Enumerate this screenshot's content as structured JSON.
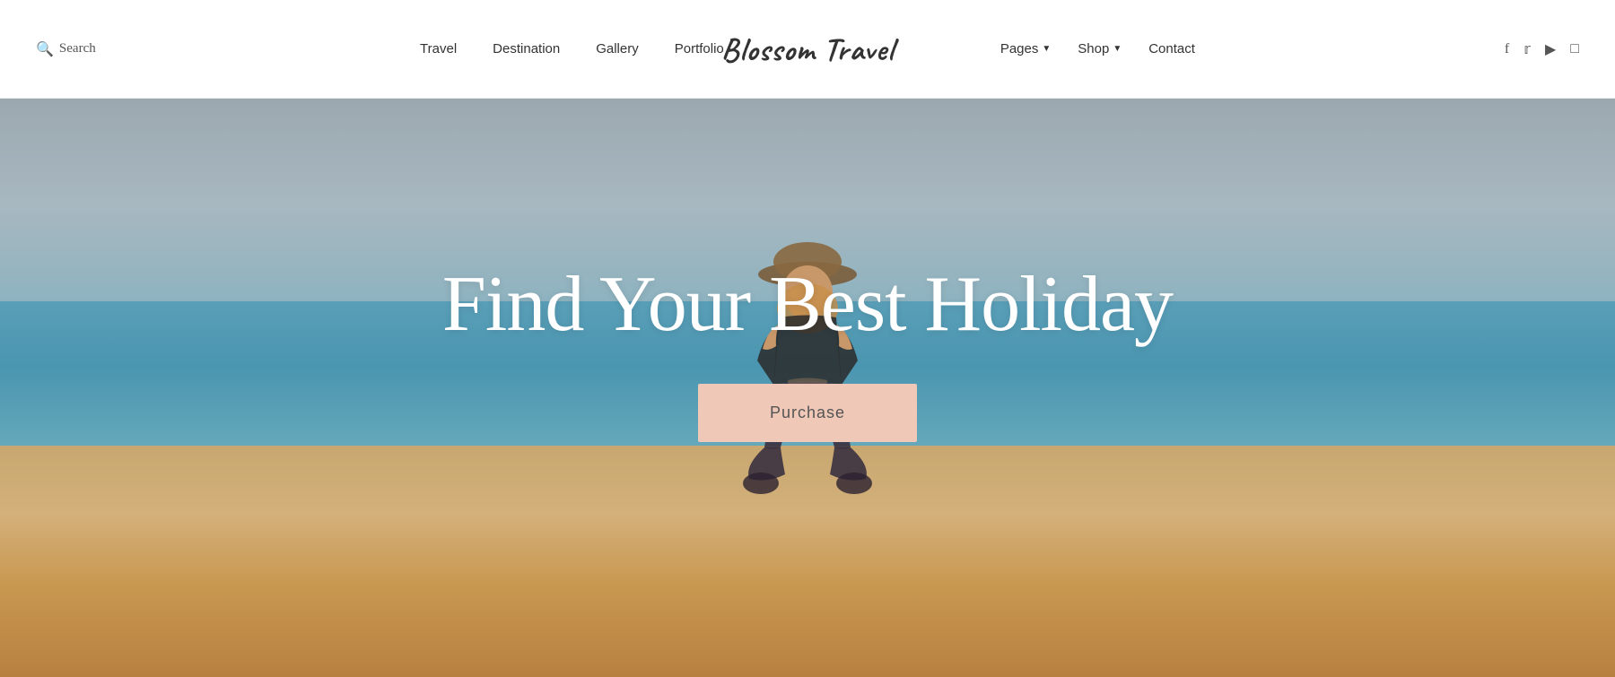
{
  "header": {
    "search_label": "Search",
    "logo": "Blossom Travel",
    "nav_left": [
      {
        "id": "travel",
        "label": "Travel"
      },
      {
        "id": "destination",
        "label": "Destination"
      },
      {
        "id": "gallery",
        "label": "Gallery"
      },
      {
        "id": "portfolio",
        "label": "Portfolio"
      }
    ],
    "nav_right": [
      {
        "id": "pages",
        "label": "Pages",
        "has_dropdown": true
      },
      {
        "id": "shop",
        "label": "Shop",
        "has_dropdown": true
      },
      {
        "id": "contact",
        "label": "Contact",
        "has_dropdown": false
      }
    ],
    "social": [
      {
        "id": "facebook",
        "icon": "f",
        "symbol": "𝐟"
      },
      {
        "id": "twitter",
        "icon": "t",
        "symbol": "🐦"
      },
      {
        "id": "youtube",
        "icon": "▶",
        "symbol": "▶"
      },
      {
        "id": "instagram",
        "icon": "◻",
        "symbol": "⬜"
      }
    ]
  },
  "hero": {
    "title": "Find Your Best Holiday",
    "purchase_label": "Purchase"
  }
}
